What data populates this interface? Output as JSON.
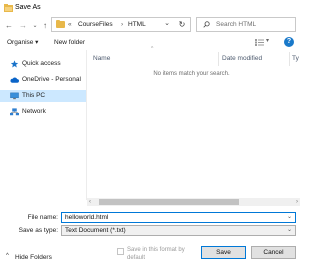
{
  "window": {
    "title": "Save As"
  },
  "address_bar": {
    "overflow_chevron": "«",
    "breadcrumb": [
      "CourseFiles",
      "HTML"
    ],
    "separator": "›",
    "search_placeholder": "Search HTML"
  },
  "toolbar": {
    "organise_label": "Organise ▾",
    "new_folder_label": "New folder"
  },
  "nav_pane": {
    "items": [
      {
        "label": "Quick access",
        "icon": "star-icon",
        "color": "#1a73c9"
      },
      {
        "label": "OneDrive - Personal",
        "icon": "cloud-icon",
        "color": "#0a64c8"
      },
      {
        "label": "This PC",
        "icon": "computer-icon",
        "color": "#3a8fd9",
        "selected": true
      },
      {
        "label": "Network",
        "icon": "network-icon",
        "color": "#2f7fcf"
      }
    ]
  },
  "file_list": {
    "columns": [
      "Name",
      "Date modified",
      "Ty"
    ],
    "empty_message": "No items match your search."
  },
  "form": {
    "file_name_label": "File name:",
    "file_name_value": "helloworld.html",
    "save_as_type_label": "Save as type:",
    "save_as_type_value": "Text Document (*.txt)",
    "save_format_checkbox_label": "Save in this format by default"
  },
  "buttons": {
    "save": "Save",
    "cancel": "Cancel",
    "hide_folders": "Hide Folders"
  },
  "colors": {
    "accent": "#0078d7",
    "selection": "#cce8ff",
    "folder": "#e8b84a"
  }
}
